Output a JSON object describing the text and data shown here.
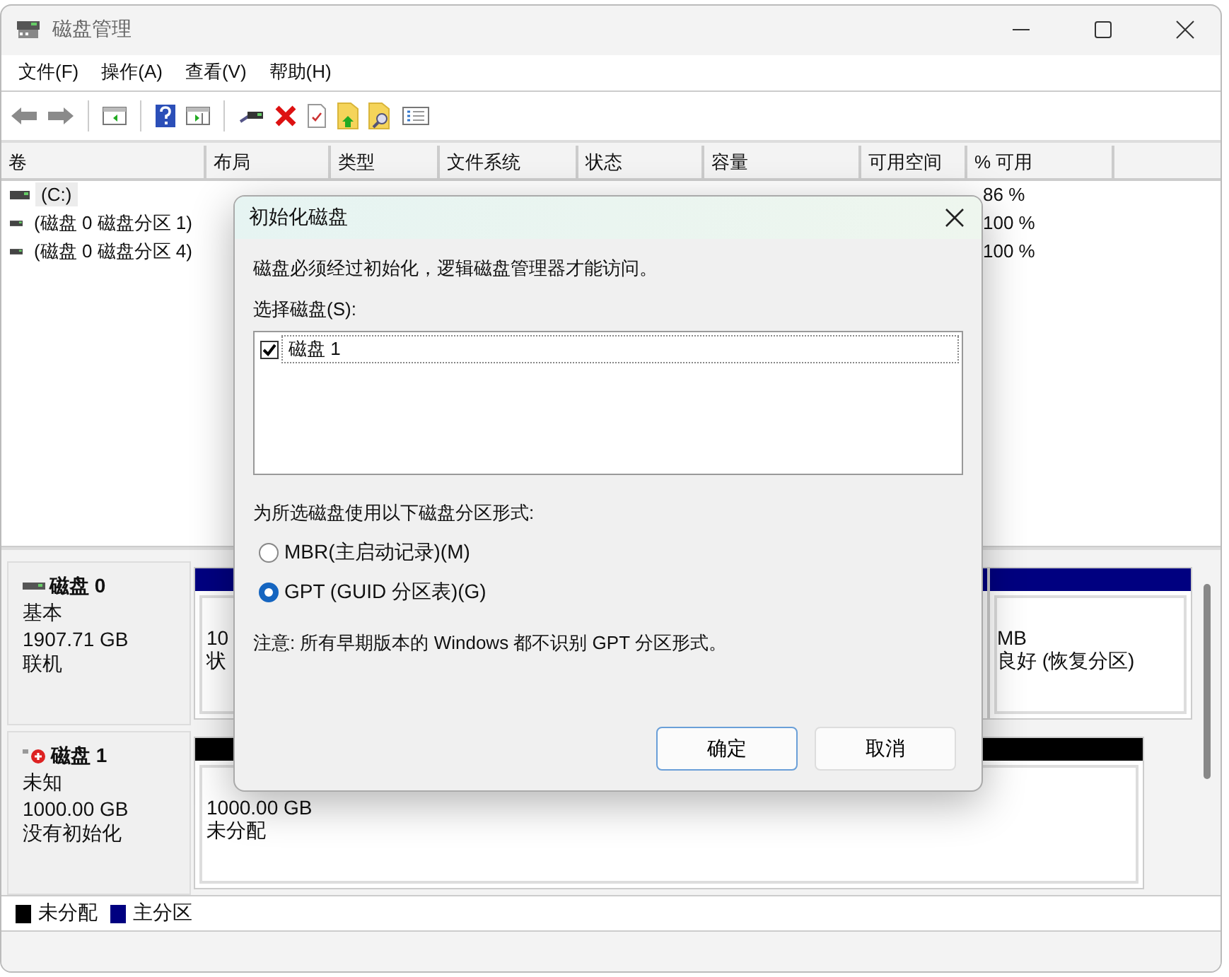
{
  "window": {
    "title": "磁盘管理"
  },
  "menu": [
    "文件(F)",
    "操作(A)",
    "查看(V)",
    "帮助(H)"
  ],
  "table": {
    "columns": [
      "卷",
      "布局",
      "类型",
      "文件系统",
      "状态",
      "容量",
      "可用空间",
      "% 可用"
    ],
    "rows": [
      {
        "volume": "(C:)",
        "selected": true,
        "percent_free": "86 %"
      },
      {
        "volume": "(磁盘 0 磁盘分区 1)",
        "selected": false,
        "percent_free": "100 %"
      },
      {
        "volume": "(磁盘 0 磁盘分区 4)",
        "selected": false,
        "percent_free": "100 %"
      }
    ]
  },
  "disks": [
    {
      "name": "磁盘 0",
      "kind": "online",
      "type": "基本",
      "size": "1907.71 GB",
      "status": "联机",
      "partitions": [
        {
          "kind": "primary",
          "lines": [
            "10",
            "状"
          ]
        },
        {
          "kind": "primary",
          "lines": [
            "MB",
            "良好 (恢复分区)"
          ]
        }
      ]
    },
    {
      "name": "磁盘 1",
      "kind": "error",
      "type": "未知",
      "size": "1000.00 GB",
      "status": "没有初始化",
      "partitions": [
        {
          "kind": "unallocated",
          "lines": [
            "1000.00 GB",
            "未分配"
          ]
        }
      ]
    }
  ],
  "legend": [
    {
      "kind": "unallocated",
      "label": "未分配",
      "color": "#000000"
    },
    {
      "kind": "primary",
      "label": "主分区",
      "color": "#000080"
    }
  ],
  "dialog": {
    "title": "初始化磁盘",
    "message": "磁盘必须经过初始化，逻辑磁盘管理器才能访问。",
    "select_label": "选择磁盘(S):",
    "disks": [
      {
        "label": "磁盘 1",
        "checked": true
      }
    ],
    "style_label": "为所选磁盘使用以下磁盘分区形式:",
    "options": [
      {
        "label": "MBR(主启动记录)(M)",
        "selected": false
      },
      {
        "label": "GPT (GUID 分区表)(G)",
        "selected": true
      }
    ],
    "note": "注意: 所有早期版本的 Windows 都不识别 GPT 分区形式。",
    "buttons": [
      {
        "label": "确定",
        "default": true
      },
      {
        "label": "取消",
        "default": false
      }
    ]
  }
}
